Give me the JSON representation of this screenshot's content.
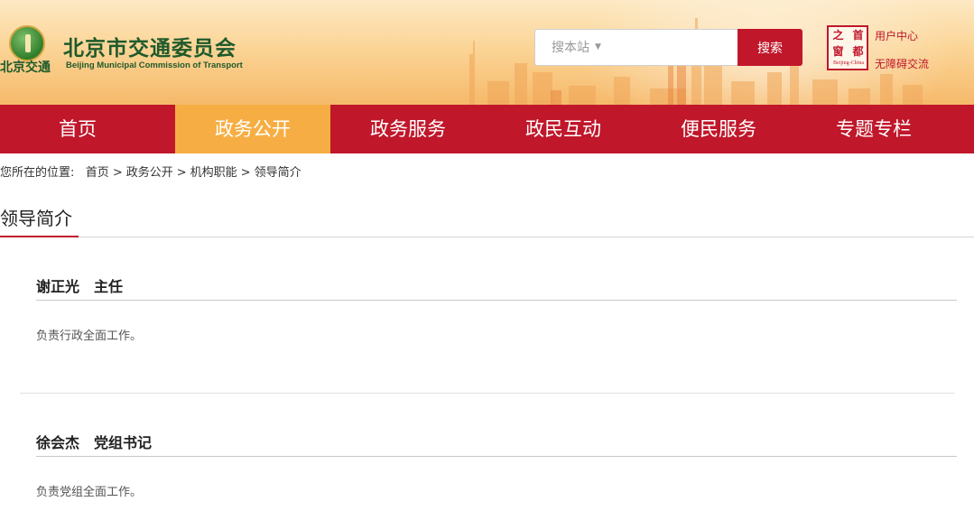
{
  "header": {
    "logo_short": "北京交通",
    "logo_name": "北京市交通委员会",
    "logo_en": "Beijing Municipal Commission of Transport",
    "search": {
      "placeholder": "搜本站",
      "button": "搜索"
    },
    "seal": {
      "chars": [
        "之",
        "首",
        "窗",
        "都"
      ],
      "foot": "Beijing-China"
    },
    "links": {
      "user_center": "用户中心",
      "accessibility": "无障碍交流"
    }
  },
  "nav": {
    "items": [
      {
        "label": "首页",
        "active": false
      },
      {
        "label": "政务公开",
        "active": true
      },
      {
        "label": "政务服务",
        "active": false
      },
      {
        "label": "政民互动",
        "active": false
      },
      {
        "label": "便民服务",
        "active": false
      },
      {
        "label": "专题专栏",
        "active": false
      }
    ]
  },
  "breadcrumb": {
    "prefix": "您所在的位置:",
    "items": [
      "首页",
      "政务公开",
      "机构职能",
      "领导简介"
    ],
    "separator": ">"
  },
  "section": {
    "title": "领导简介"
  },
  "leaders": [
    {
      "name": "谢正光　主任",
      "duty": "负责行政全面工作。"
    },
    {
      "name": "徐会杰　党组书记",
      "duty": "负责党组全面工作。"
    }
  ],
  "colors": {
    "brand_red": "#c0172b",
    "nav_active": "#f6ae44",
    "logo_green": "#1f5a2b"
  },
  "icons": [
    "emblem-icon",
    "chevron-down-icon",
    "seal-icon"
  ]
}
